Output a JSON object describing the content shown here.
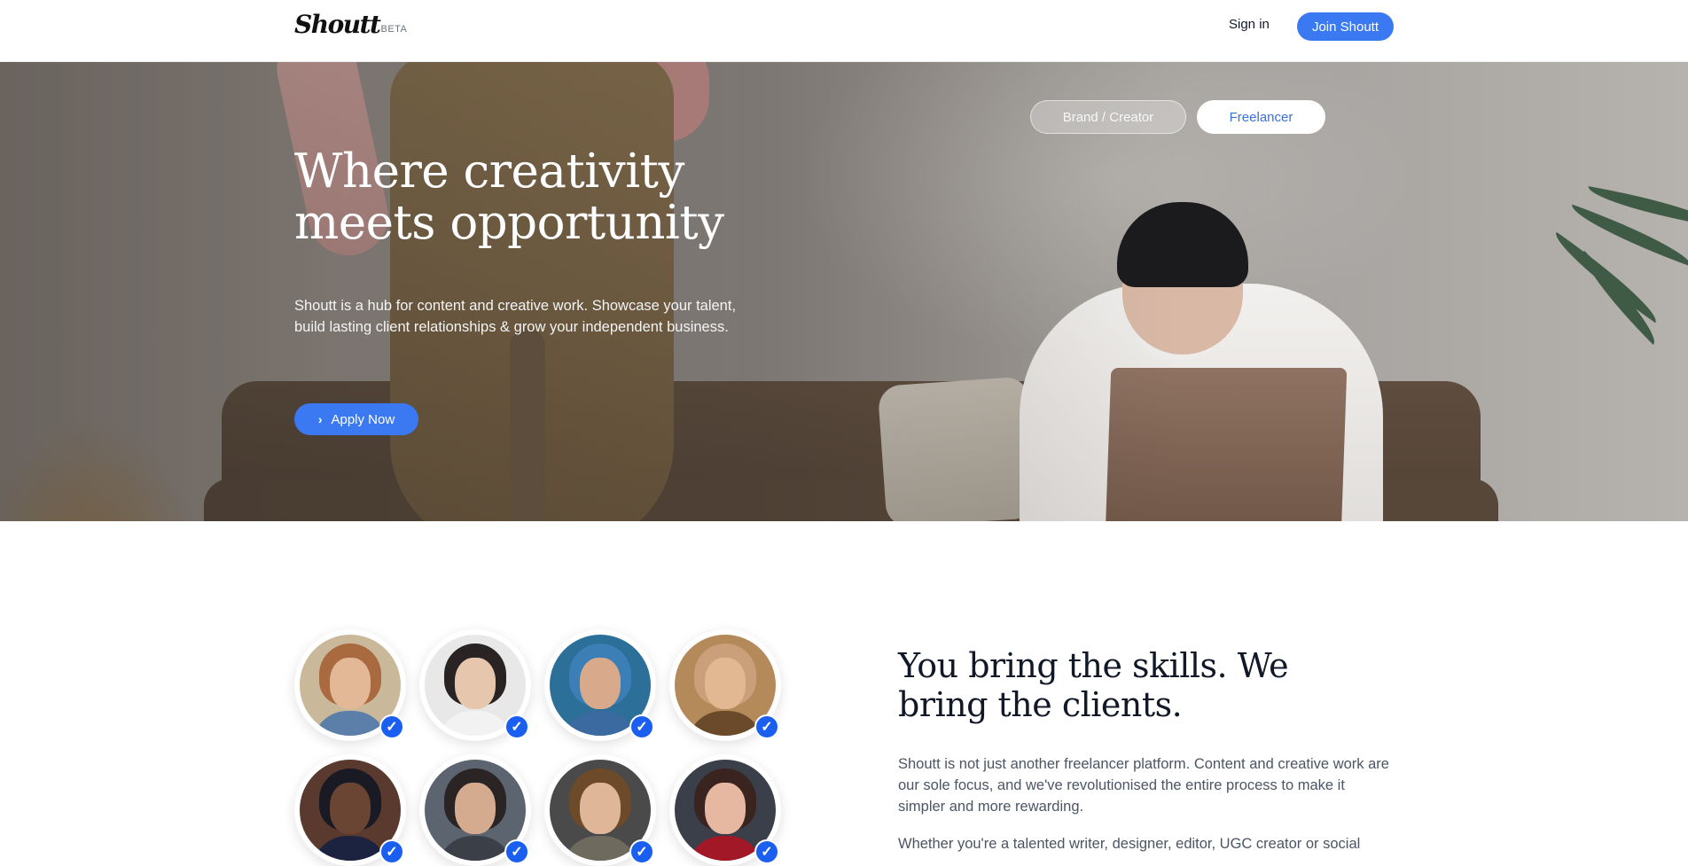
{
  "header": {
    "logo_text": "Shoutt",
    "logo_badge": "BETA",
    "signin_label": "Sign in",
    "join_label": "Join Shoutt"
  },
  "hero": {
    "toggle": {
      "options": [
        "Brand / Creator",
        "Freelancer"
      ],
      "selected": "Freelancer"
    },
    "title": "Where creativity meets opportunity",
    "description": "Shoutt is a hub for content and creative work. Showcase your talent, build lasting client relationships & grow your independent business.",
    "cta_label": "Apply Now",
    "cta_icon": "chevron-right-icon"
  },
  "skills_section": {
    "title": "You bring the skills. We bring the clients.",
    "paragraph_1": "Shoutt is not just another freelancer platform. Content and creative work are our sole focus, and we've revolutionised the entire process to make it simpler and more rewarding.",
    "paragraph_2": "Whether you're a talented writer, designer, editor, UGC creator or social"
  },
  "avatars": [
    {
      "verified": true,
      "bg": "#c9b99a",
      "hair": "#a86a3e",
      "skin": "#e3b896",
      "shirt": "#5b7fa8"
    },
    {
      "verified": true,
      "bg": "#e8e8e8",
      "hair": "#2a2323",
      "skin": "#e7c6ae",
      "shirt": "#f2f2f2"
    },
    {
      "verified": true,
      "bg": "#2c6f98",
      "hair": "#3b7fb6",
      "skin": "#d9a98c",
      "shirt": "#3a6aa0"
    },
    {
      "verified": true,
      "bg": "#b48a5a",
      "hair": "#caa07a",
      "skin": "#e2b893",
      "shirt": "#6b4a2c"
    },
    {
      "verified": true,
      "bg": "#5a3a2e",
      "hair": "#1a1a24",
      "skin": "#6b4533",
      "shirt": "#1c2340"
    },
    {
      "verified": true,
      "bg": "#5c6470",
      "hair": "#2a2424",
      "skin": "#d5ab90",
      "shirt": "#3a3f48"
    },
    {
      "verified": true,
      "bg": "#4a4a4a",
      "hair": "#6d4a2a",
      "skin": "#e0b699",
      "shirt": "#6f6a5e"
    },
    {
      "verified": true,
      "bg": "#3a3f4a",
      "hair": "#3a2420",
      "skin": "#e6b8a2",
      "shirt": "#a31826"
    }
  ],
  "colors": {
    "accent": "#3b79f3",
    "badge": "#1a5ff0",
    "heading": "#111827",
    "body_text": "#4b5563"
  }
}
